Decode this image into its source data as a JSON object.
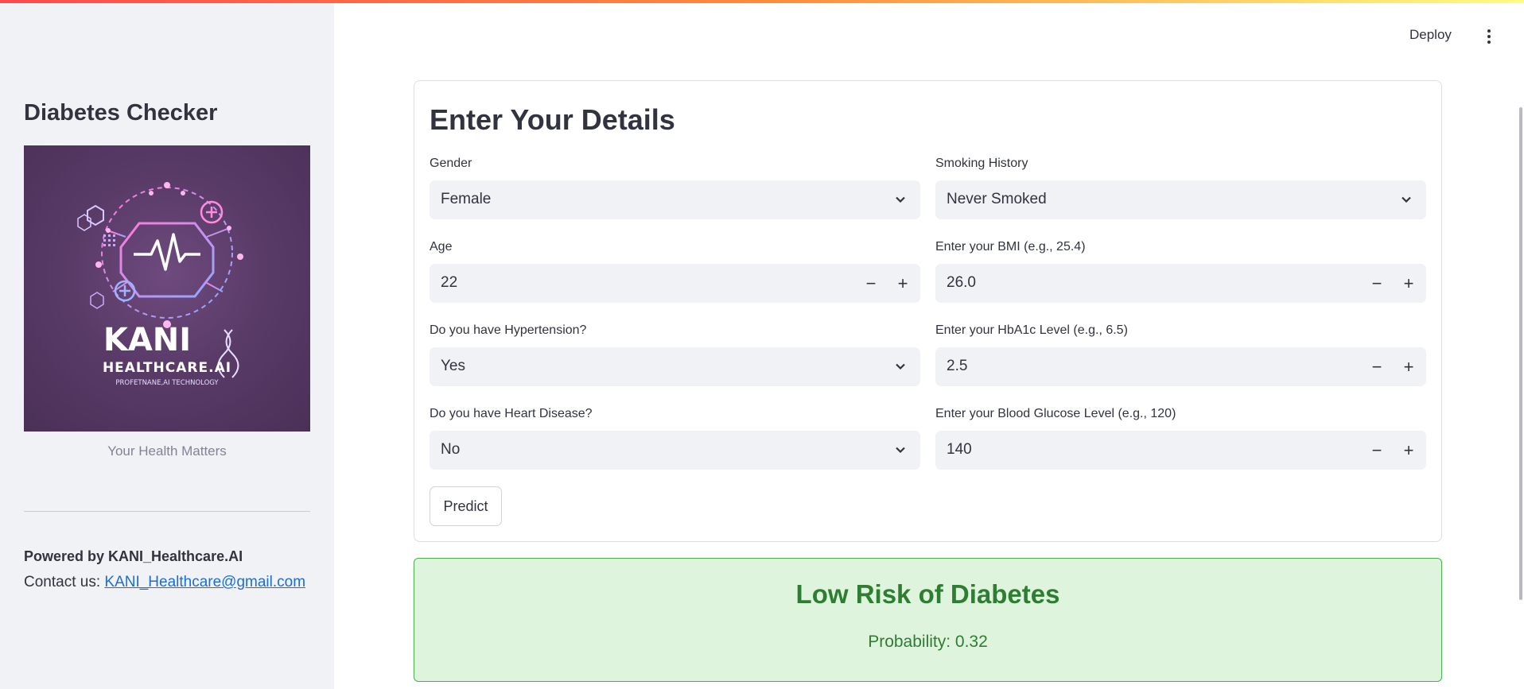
{
  "header": {
    "deploy_label": "Deploy",
    "menu_icon": "vertical-dots-icon"
  },
  "sidebar": {
    "title": "Diabetes Checker",
    "logo": {
      "brand_line1": "KANI",
      "brand_line2": "HEALTHCARE.AI",
      "tagline": "PROFETNANE,AI TECHNOLOGY"
    },
    "caption": "Your Health Matters",
    "powered_by": "Powered by KANI_Healthcare.AI",
    "contact_prefix": "Contact us:",
    "contact_email": "KANI_Healthcare@gmail.com"
  },
  "form": {
    "title": "Enter Your Details",
    "gender": {
      "label": "Gender",
      "value": "Female"
    },
    "smoking": {
      "label": "Smoking History",
      "value": "Never Smoked"
    },
    "age": {
      "label": "Age",
      "value": "22"
    },
    "bmi": {
      "label": "Enter your BMI (e.g., 25.4)",
      "value": "26.0"
    },
    "hypertension": {
      "label": "Do you have Hypertension?",
      "value": "Yes"
    },
    "hba1c": {
      "label": "Enter your HbA1c Level (e.g., 6.5)",
      "value": "2.5"
    },
    "heart_disease": {
      "label": "Do you have Heart Disease?",
      "value": "No"
    },
    "glucose": {
      "label": "Enter your Blood Glucose Level (e.g., 120)",
      "value": "140"
    },
    "stepper_minus": "−",
    "stepper_plus": "+",
    "predict_label": "Predict"
  },
  "result": {
    "title": "Low Risk of Diabetes",
    "probability_text": "Probability: 0.32"
  },
  "colors": {
    "sidebar_bg": "#f0f2f6",
    "result_bg": "#dff4dc",
    "result_text": "#2e7d32",
    "link": "#1c6fd0"
  }
}
